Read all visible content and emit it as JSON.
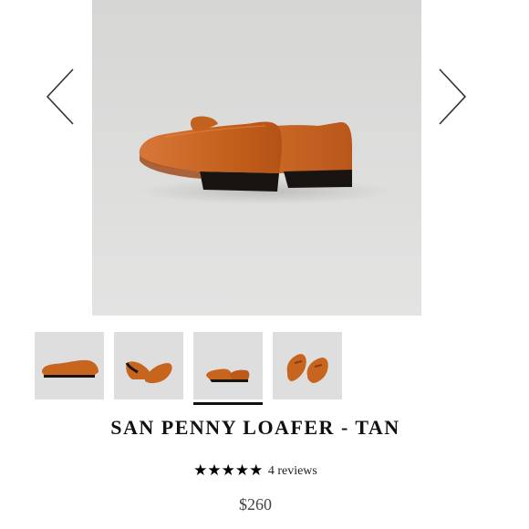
{
  "product": {
    "title": "SAN PENNY LOAFER - TAN",
    "stars": "★★★★★",
    "rating_value": 5,
    "reviews": "4 reviews",
    "price": "$260"
  },
  "gallery": {
    "main_image": "tan-penny-loafers-back-view",
    "prev_icon": "chevron-left-icon",
    "next_icon": "chevron-right-icon",
    "thumbnails": [
      {
        "name": "loafer-side-view",
        "selected": false
      },
      {
        "name": "loafer-sole-view",
        "selected": false
      },
      {
        "name": "loafer-back-view",
        "selected": true
      },
      {
        "name": "loafer-top-view",
        "selected": false
      }
    ]
  },
  "colors": {
    "leather": "#c7651f",
    "sole": "#1a1410",
    "background": "#dcdcdb"
  }
}
